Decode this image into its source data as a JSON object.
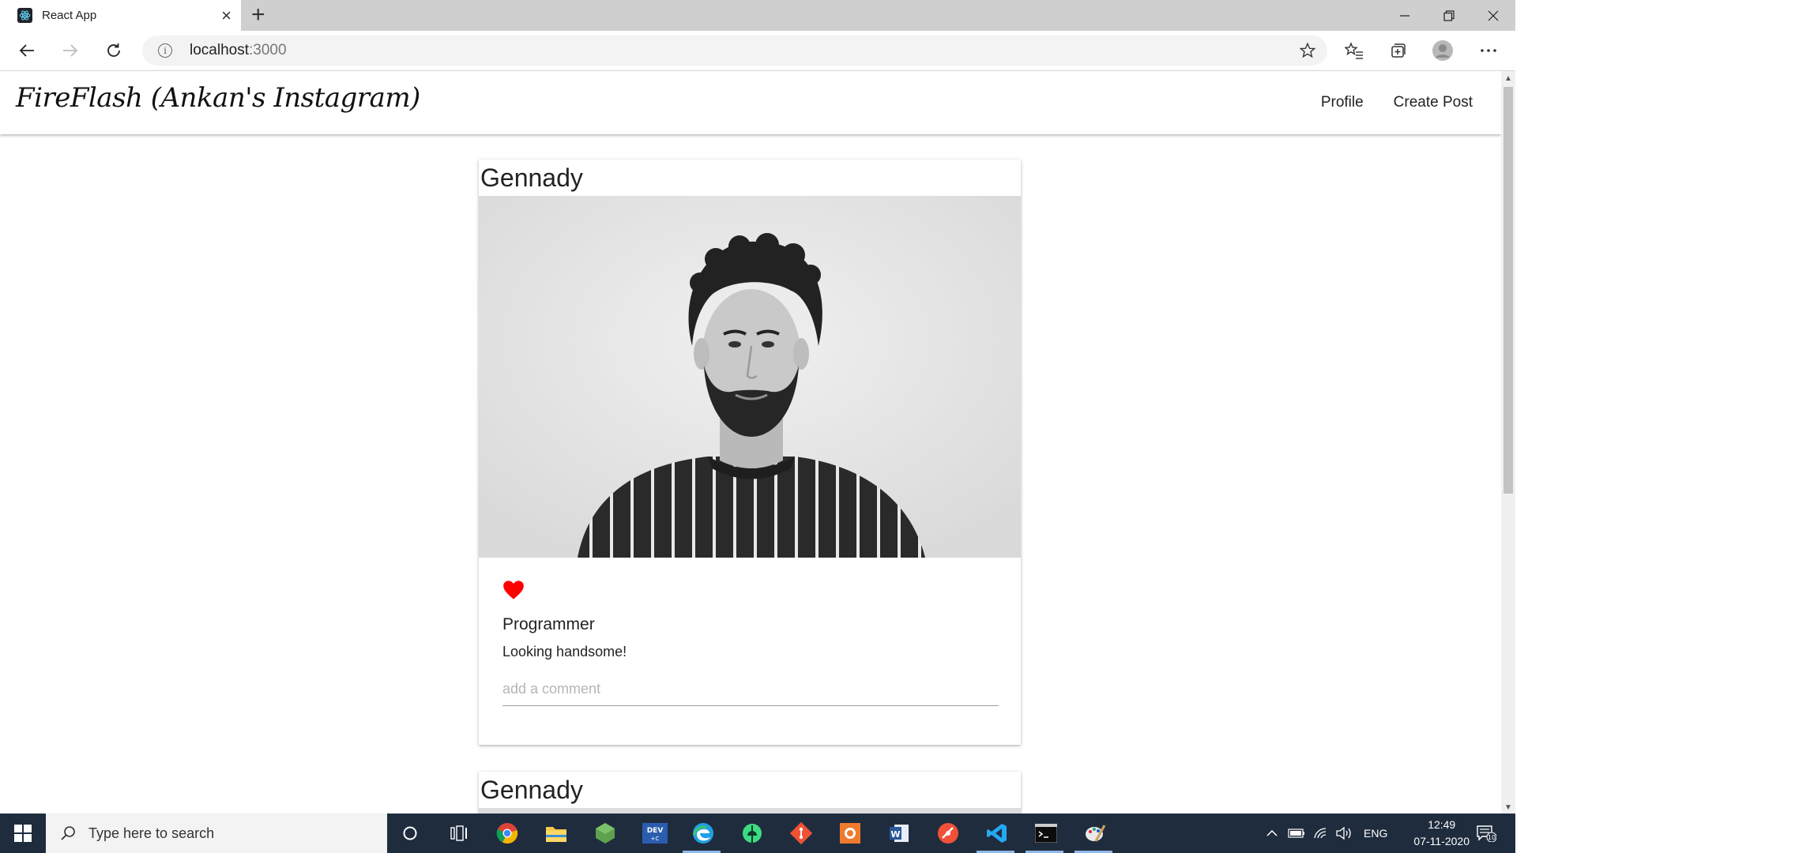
{
  "browser": {
    "tab_title": "React App",
    "url_host": "localhost",
    "url_port": ":3000"
  },
  "app": {
    "brand": "FireFlash (Ankan's Instagram)",
    "nav": [
      "Profile",
      "Create Post"
    ]
  },
  "posts": [
    {
      "author": "Gennady",
      "liked": true,
      "title": "Programmer",
      "body": "Looking handsome!",
      "comment_placeholder": "add a comment"
    },
    {
      "author": "Gennady"
    }
  ],
  "taskbar": {
    "search_placeholder": "Type here to search",
    "pinned": [
      "circle-icon",
      "task-view-icon",
      "chrome-icon",
      "file-explorer-icon",
      "nodejs-icon",
      "dev-icon",
      "edge-icon",
      "android-studio-icon",
      "git-icon",
      "postman-icon",
      "word-icon",
      "swift-icon",
      "vscode-icon",
      "terminal-icon",
      "paint-icon"
    ],
    "language": "ENG",
    "time": "12:49",
    "date": "07-11-2020",
    "notification_count": "10"
  },
  "colors": {
    "heart": "#ff0000",
    "taskbar": "#1f2c3e",
    "edge_accent": "#8fb8e8"
  }
}
